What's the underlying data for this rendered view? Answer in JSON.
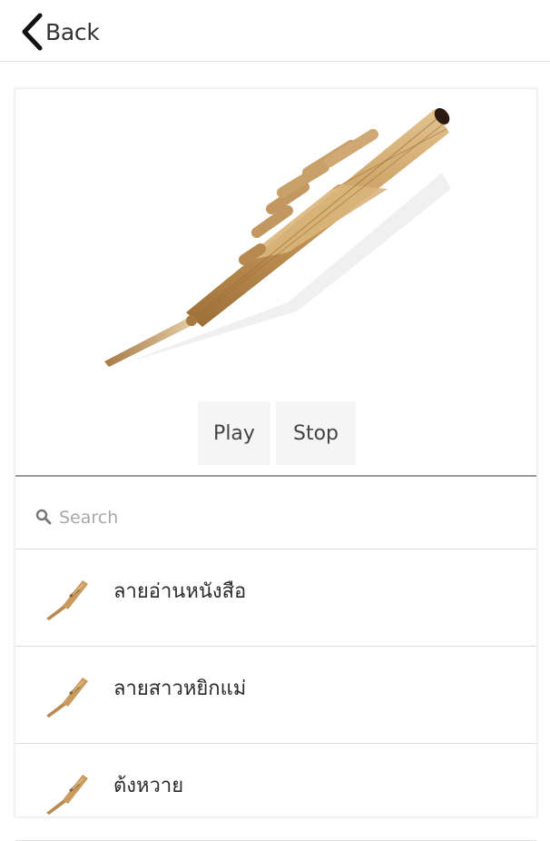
{
  "header": {
    "back_label": "Back",
    "back_icon": "chevron-left-icon"
  },
  "player": {
    "image": "khaen-instrument-image",
    "play_label": "Play",
    "stop_label": "Stop"
  },
  "search": {
    "placeholder": "Search",
    "value": "",
    "icon": "search-icon"
  },
  "songs": [
    {
      "title": "ลายอ่านหนังสือ",
      "icon": "khaen-icon"
    },
    {
      "title": "ลายสาวหยิกแม่",
      "icon": "khaen-icon"
    },
    {
      "title": "ต้งหวาย",
      "icon": "khaen-icon"
    }
  ],
  "colors": {
    "accent": "#333333",
    "button_bg": "#f5f5f5",
    "bamboo": "#c9a26a"
  }
}
